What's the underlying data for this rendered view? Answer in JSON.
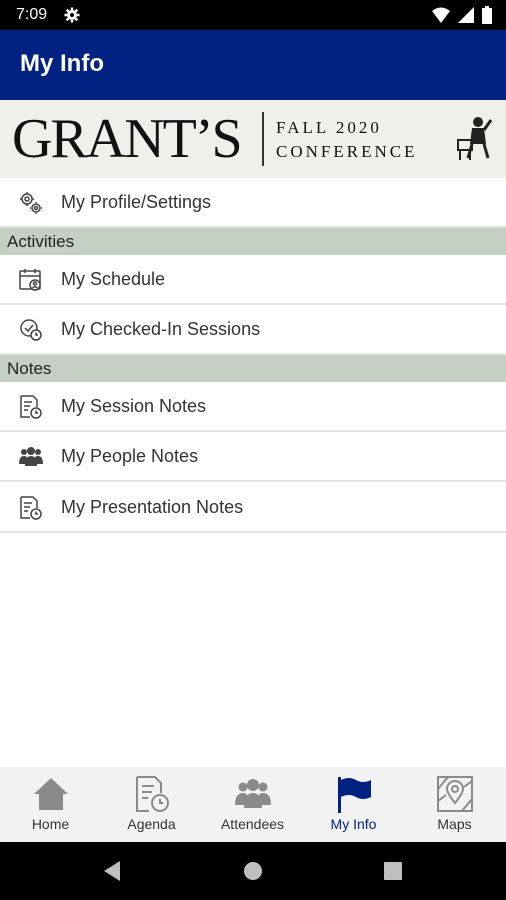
{
  "status": {
    "time": "7:09"
  },
  "header": {
    "title": "My Info"
  },
  "banner": {
    "logo_text": "GRANT’S",
    "line1": "FALL 2020",
    "line2": "CONFERENCE"
  },
  "profile_item": {
    "label": "My Profile/Settings",
    "icon": "gears-icon"
  },
  "sections": [
    {
      "title": "Activities",
      "items": [
        {
          "label": "My Schedule",
          "icon": "calendar-person-icon"
        },
        {
          "label": "My Checked-In Sessions",
          "icon": "check-clock-icon"
        }
      ]
    },
    {
      "title": "Notes",
      "items": [
        {
          "label": "My Session Notes",
          "icon": "notes-clock-icon"
        },
        {
          "label": "My People Notes",
          "icon": "people-icon"
        },
        {
          "label": "My Presentation Notes",
          "icon": "notes-clock-icon"
        }
      ]
    }
  ],
  "bottom_nav": [
    {
      "label": "Home",
      "icon": "home-icon",
      "active": false
    },
    {
      "label": "Agenda",
      "icon": "agenda-icon",
      "active": false
    },
    {
      "label": "Attendees",
      "icon": "attendees-icon",
      "active": false
    },
    {
      "label": "My Info",
      "icon": "flag-icon",
      "active": true
    },
    {
      "label": "Maps",
      "icon": "map-icon",
      "active": false
    }
  ],
  "colors": {
    "primary": "#022282",
    "section_bg": "#c6cfc4",
    "nav_bg": "#f2f2f2"
  }
}
